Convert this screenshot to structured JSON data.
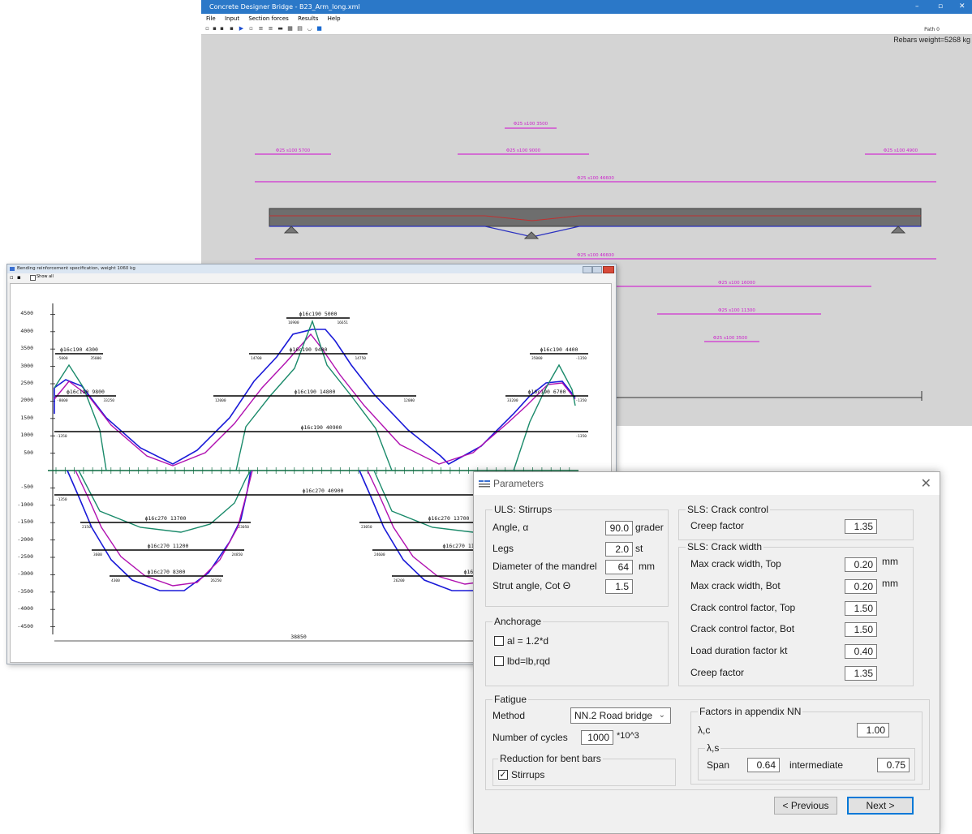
{
  "main_window": {
    "title": "Concrete Designer Bridge - B23_Arm_long.xml",
    "window_controls": [
      "–",
      "▫",
      "✕"
    ],
    "menu": [
      "File",
      "Input",
      "Section forces",
      "Results",
      "Help"
    ],
    "path_label": "Path 0",
    "rebars_weight": "Rebars weight=5268 kg",
    "top_rebars": [
      {
        "label": "Φ25 s100 3500"
      },
      {
        "label": "Φ25 s100 5700"
      },
      {
        "label": "Φ25 s100 9000"
      },
      {
        "label": "Φ25 s100 4900"
      },
      {
        "label": "Φ25 s100 46600"
      }
    ],
    "bottom_rebars": [
      {
        "label": "Φ25 s100 46600"
      },
      {
        "label": "Φ25 s100 16000"
      },
      {
        "label": "Φ25 s100 11300"
      },
      {
        "label": "Φ25 s100 3500"
      }
    ]
  },
  "bending_window": {
    "title": "Bending reinforcement specification, weight 1060 kg",
    "checkbox_label": "Show all",
    "y_ticks": [
      "4500",
      "4000",
      "3500",
      "3000",
      "2500",
      "2000",
      "1500",
      "1000",
      "500",
      "-500",
      "-1000",
      "-1500",
      "-2000",
      "-2500",
      "-3000",
      "-3500",
      "-4000",
      "-4500"
    ],
    "top_bars": [
      {
        "label": "ϕ16c190 5000",
        "left": "16900",
        "right": "16651"
      },
      {
        "label": "ϕ16c190 4300",
        "left": "-5000",
        "right": "35000"
      },
      {
        "label": "ϕ16c190 9400",
        "left": "14700",
        "right": "14750"
      },
      {
        "label": "ϕ16c190 4400",
        "left": "35000",
        "right": "-1350"
      },
      {
        "label": "ϕ16c190 9800",
        "left": "-8000",
        "right": "33250"
      },
      {
        "label": "ϕ16c190 14800",
        "left": "12000",
        "right": "12000"
      },
      {
        "label": "ϕ16c190 6700",
        "left": "33200",
        "right": "-1350"
      },
      {
        "label": "ϕ16c190 40900",
        "left": "-1350",
        "right": "-1350"
      }
    ],
    "bottom_bars": [
      {
        "label": "ϕ16c270 40900",
        "left": "-1350"
      },
      {
        "label": "ϕ16c270 13700",
        "left": "2150",
        "right": "23050"
      },
      {
        "label": "ϕ16c270 13700",
        "left": "23050"
      },
      {
        "label": "ϕ16c270 11200",
        "left": "3600",
        "right": "24850"
      },
      {
        "label": "ϕ16c270 1120",
        "left": "24600"
      },
      {
        "label": "ϕ16c270 8300",
        "left": "4300",
        "right": "26250"
      },
      {
        "label": "ϕ16c270 840",
        "left": "26200"
      }
    ],
    "span_label": "38850",
    "colors": {
      "envelope": "#1a1ad8",
      "moment": "#b010b0",
      "shear": "#1a8a6a",
      "rebar": "#000000"
    }
  },
  "dialog": {
    "title": "Parameters",
    "close": "✕",
    "uls": {
      "title": "ULS: Stirrups",
      "angle_label": "Angle, α",
      "angle_value": "90.0",
      "angle_unit": "grader",
      "legs_label": "Legs",
      "legs_value": "2.0",
      "legs_unit": "st",
      "mandrel_label": "Diameter of the mandrel",
      "mandrel_value": "64",
      "mandrel_unit": "mm",
      "strut_label": "Strut angle, Cot Θ",
      "strut_value": "1.5"
    },
    "anchorage": {
      "title": "Anchorage",
      "opt1": "al = 1.2*d",
      "opt1_checked": false,
      "opt2": "lbd=lb,rqd",
      "opt2_checked": false
    },
    "sls_crack_control": {
      "title": "SLS: Crack control",
      "creep_label": "Creep factor",
      "creep_value": "1.35"
    },
    "sls_crack_width": {
      "title": "SLS: Crack width",
      "rows": [
        {
          "label": "Max crack  width, Top",
          "value": "0.20",
          "unit": "mm"
        },
        {
          "label": "Max crack width, Bot",
          "value": "0.20",
          "unit": "mm"
        },
        {
          "label": "Crack control factor, Top",
          "value": "1.50",
          "unit": ""
        },
        {
          "label": "Crack control factor, Bot",
          "value": "1.50",
          "unit": ""
        },
        {
          "label": "Load duration factor kt",
          "value": "0.40",
          "unit": ""
        },
        {
          "label": "Creep factor",
          "value": "1.35",
          "unit": ""
        }
      ]
    },
    "fatigue": {
      "title": "Fatigue",
      "method_label": "Method",
      "method_value": "NN.2 Road bridge",
      "cycles_label": "Number of cycles",
      "cycles_value": "1000",
      "cycles_unit": "*10^3",
      "reduction_title": "Reduction for bent bars",
      "stirrups_label": "Stirrups",
      "stirrups_checked": true
    },
    "factors": {
      "title": "Factors in appendix NN",
      "lambda_c_label": "λ,c",
      "lambda_c_value": "1.00",
      "lambda_s_title": "λ,s",
      "span_label": "Span",
      "span_value": "0.64",
      "intermediate_label": "intermediate",
      "intermediate_value": "0.75"
    },
    "buttons": {
      "previous": "< Previous",
      "next": "Next >"
    }
  }
}
